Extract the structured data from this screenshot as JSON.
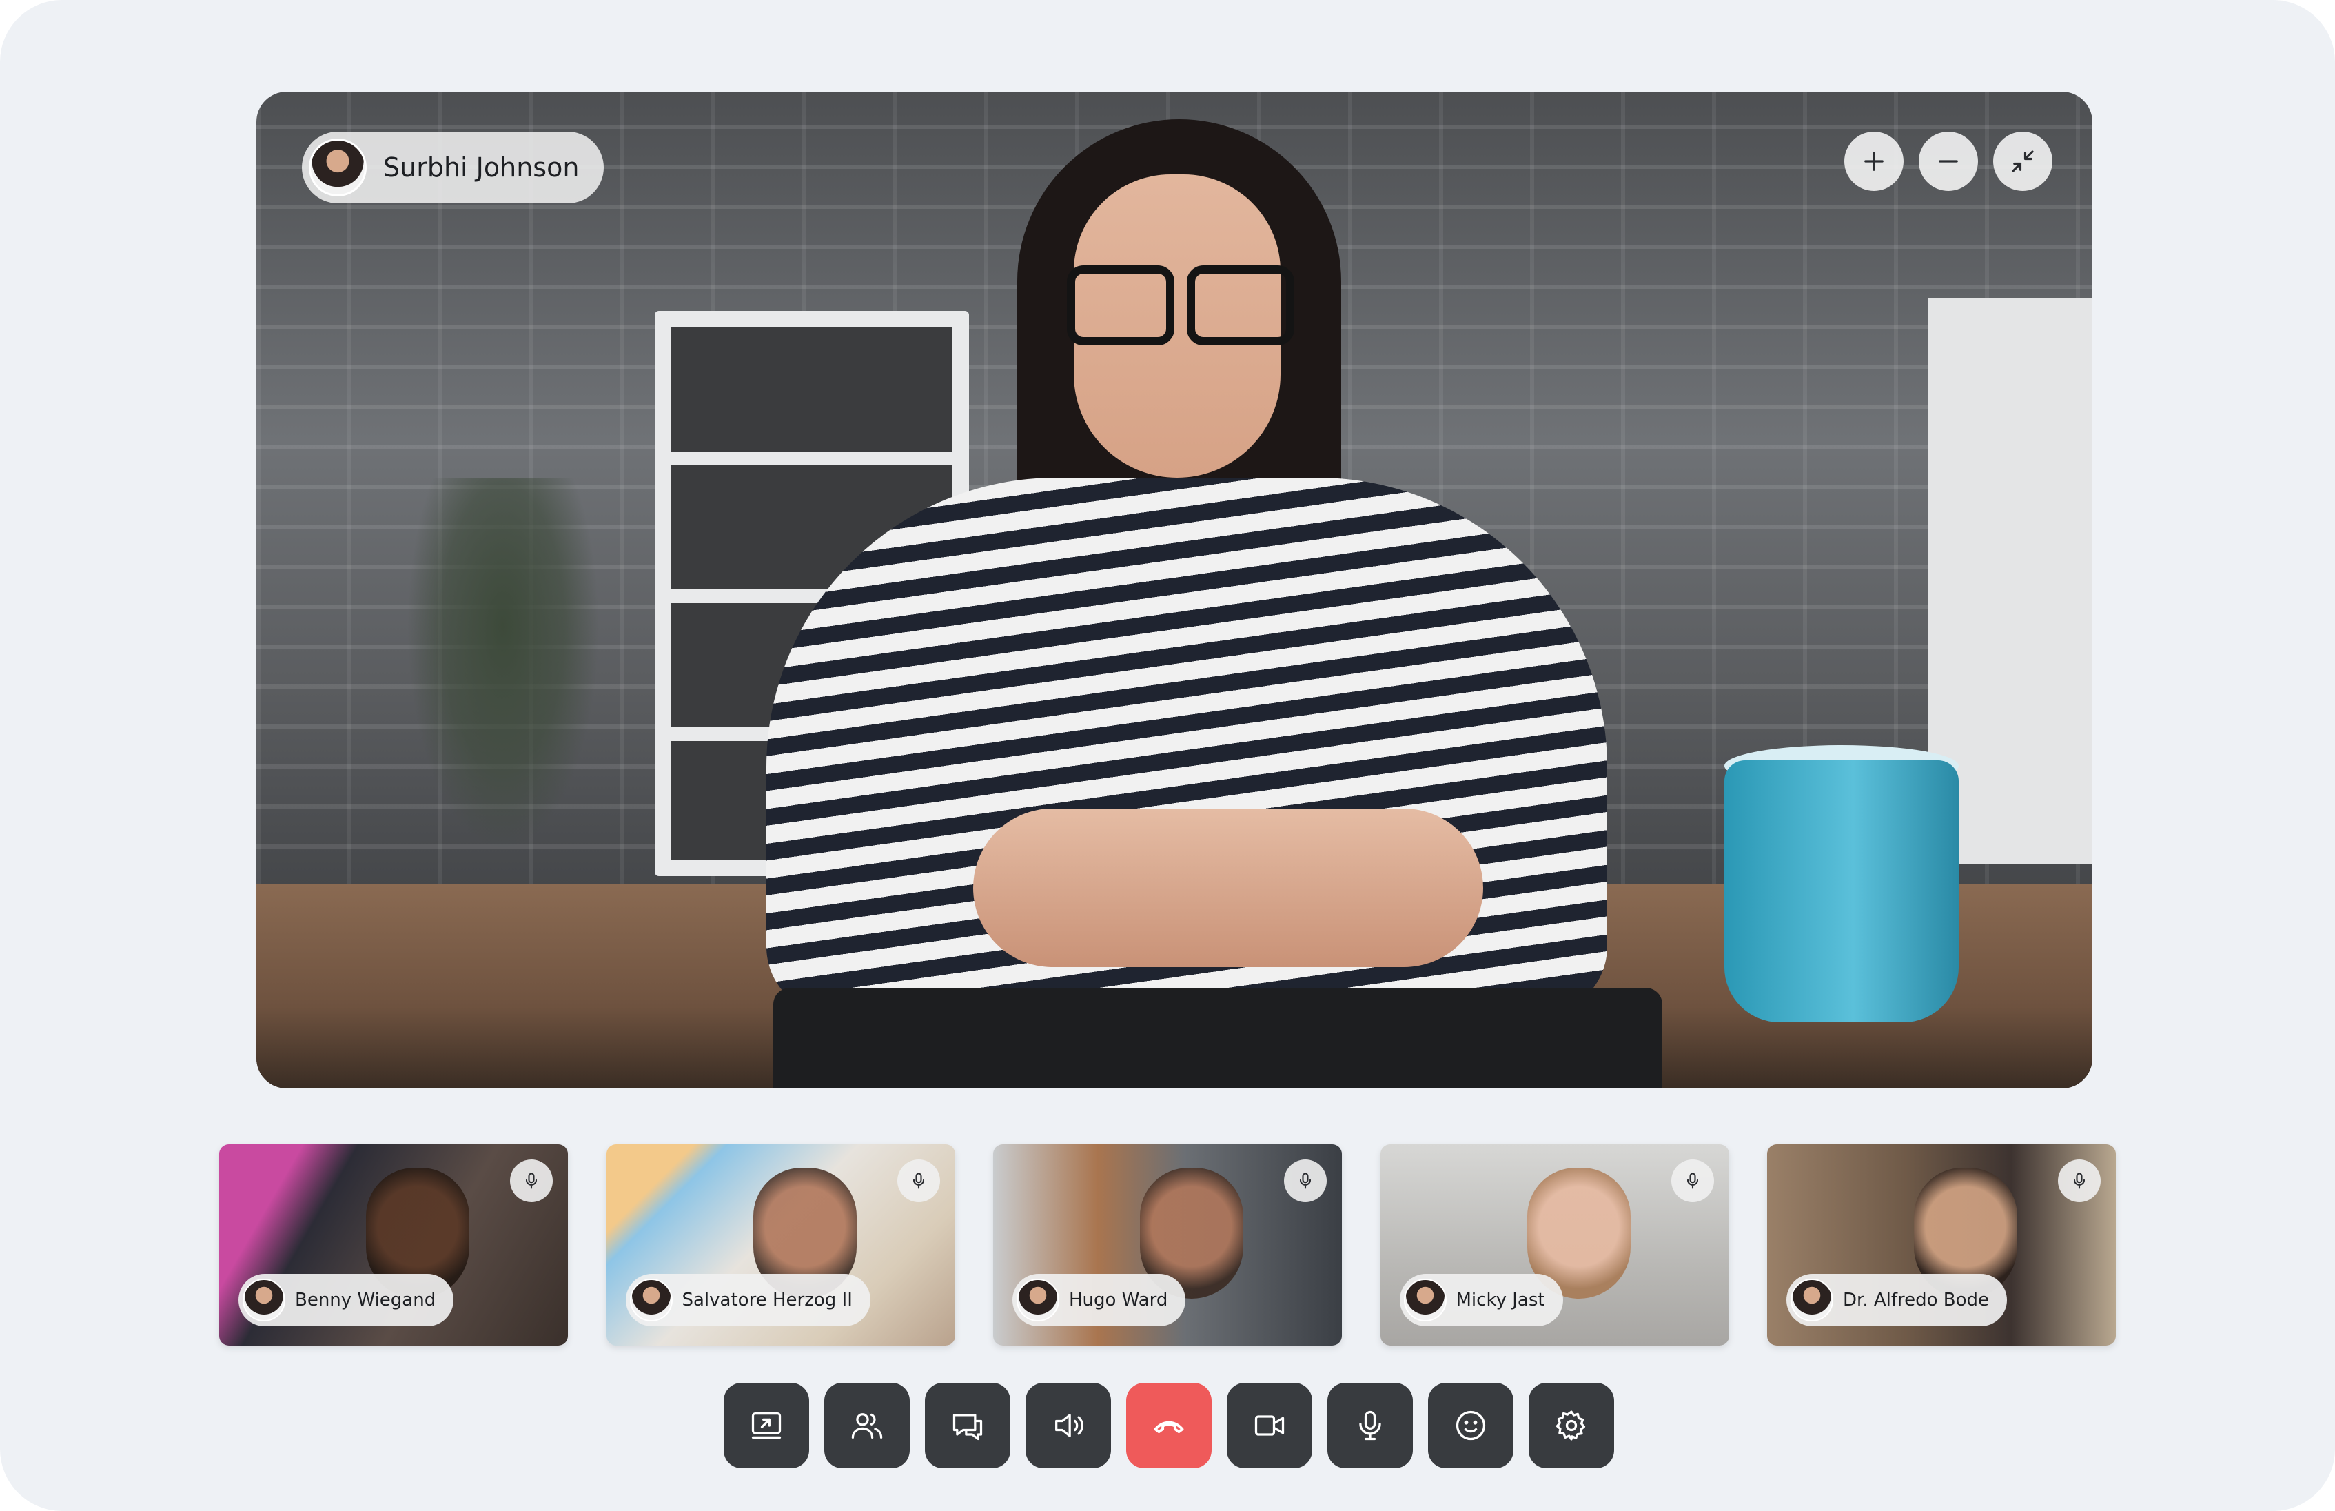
{
  "stage": {
    "speaker_name": "Surbhi Johnson",
    "controls": [
      {
        "icon": "zoom-in-icon"
      },
      {
        "icon": "zoom-out-icon"
      },
      {
        "icon": "minimize-icon"
      }
    ]
  },
  "participants": [
    {
      "name": "Benny Wiegand",
      "mic_icon": "mic-icon"
    },
    {
      "name": "Salvatore Herzog II",
      "mic_icon": "mic-icon"
    },
    {
      "name": "Hugo Ward",
      "mic_icon": "mic-icon"
    },
    {
      "name": "Micky Jast",
      "mic_icon": "mic-icon"
    },
    {
      "name": "Dr. Alfredo Bode",
      "mic_icon": "mic-icon"
    }
  ],
  "control_bar": [
    {
      "icon": "screen-share-icon"
    },
    {
      "icon": "participants-icon"
    },
    {
      "icon": "chat-icon"
    },
    {
      "icon": "speaker-icon"
    },
    {
      "icon": "end-call-icon"
    },
    {
      "icon": "video-camera-icon"
    },
    {
      "icon": "microphone-icon"
    },
    {
      "icon": "emoji-icon"
    },
    {
      "icon": "settings-icon"
    }
  ],
  "colors": {
    "background": "#eef1f5",
    "control_button": "#383b3f",
    "end_call": "#ef5a5a",
    "pill": "#f0f0f0"
  }
}
